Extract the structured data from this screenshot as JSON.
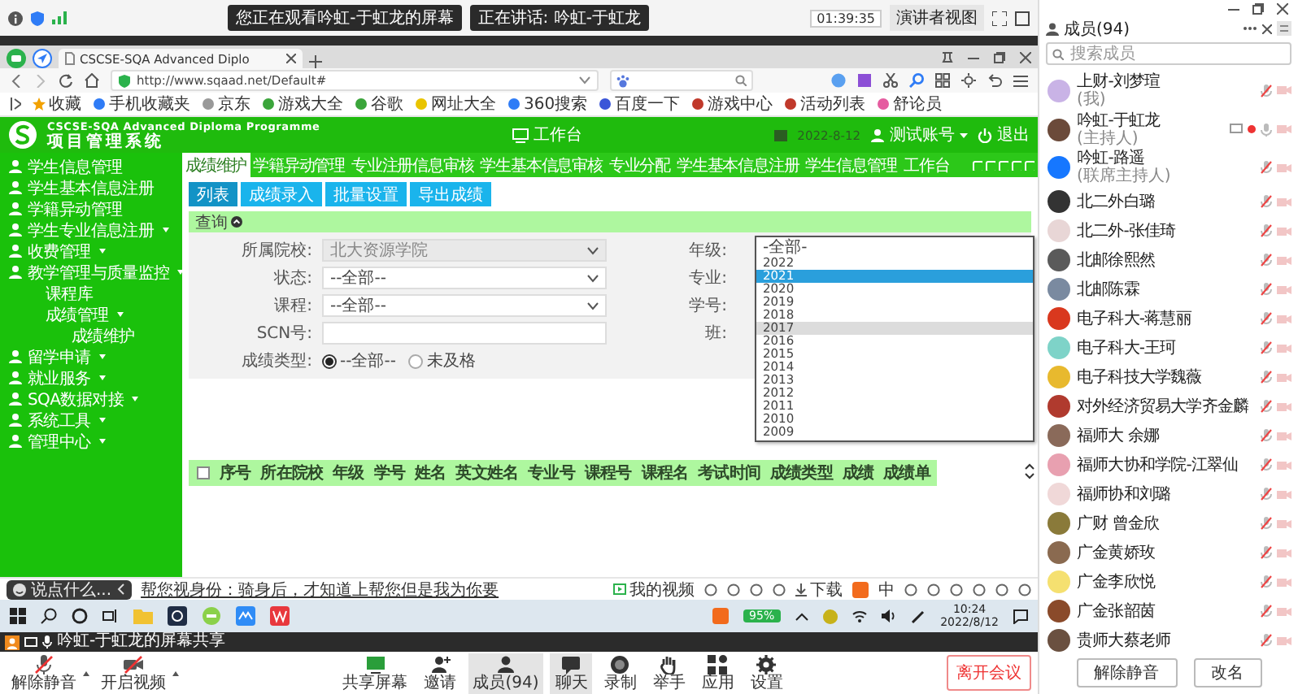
{
  "meeting_top": {
    "viewing_notice": "您正在观看吟虹-于虹龙的屏幕",
    "speaking_notice": "正在讲话: 吟虹-于虹龙",
    "timer": "01:39:35",
    "view_button": "演讲者视图"
  },
  "browser": {
    "tab_title": "CSCSE-SQA Advanced Diplo",
    "url": "http://www.sqaad.net/Default#",
    "bookmarks": [
      "收藏",
      "手机收藏夹",
      "京东",
      "游戏大全",
      "谷歌",
      "网址大全",
      "360搜索",
      "百度一下",
      "游戏中心",
      "活动列表",
      "舒论员"
    ]
  },
  "app": {
    "title_en": "CSCSE-SQA Advanced Diploma Programme",
    "title": "项目管理系统",
    "workbench": "工作台",
    "date": "2022-8-12",
    "account": "测试账号",
    "logout": "退出",
    "sidebar": {
      "items": [
        {
          "label": "学生信息管理",
          "kind": "link"
        },
        {
          "label": "学生基本信息注册",
          "kind": "link"
        },
        {
          "label": "学籍异动管理",
          "kind": "link"
        },
        {
          "label": "学生专业信息注册",
          "kind": "group"
        },
        {
          "label": "收费管理",
          "kind": "group"
        },
        {
          "label": "教学管理与质量监控",
          "kind": "group",
          "children": [
            {
              "label": "课程库",
              "kind": "link"
            },
            {
              "label": "成绩管理",
              "kind": "group",
              "children": [
                {
                  "label": "成绩维护",
                  "kind": "link"
                }
              ]
            }
          ]
        },
        {
          "label": "留学申请",
          "kind": "group"
        },
        {
          "label": "就业服务",
          "kind": "group"
        },
        {
          "label": "SQA数据对接",
          "kind": "group"
        },
        {
          "label": "系统工具",
          "kind": "group"
        },
        {
          "label": "管理中心",
          "kind": "group"
        }
      ]
    },
    "tabs": [
      {
        "label": "成绩维护",
        "selected": true
      },
      {
        "label": "学籍异动管理",
        "selected": false
      },
      {
        "label": "专业注册信息审核",
        "selected": false
      },
      {
        "label": "学生基本信息审核",
        "selected": false
      },
      {
        "label": "专业分配",
        "selected": false
      },
      {
        "label": "学生基本信息注册",
        "selected": false
      },
      {
        "label": "学生信息管理",
        "selected": false
      },
      {
        "label": "工作台",
        "selected": false
      }
    ],
    "toolbar_buttons": [
      {
        "label": "列表",
        "selected": true
      },
      {
        "label": "成绩录入",
        "selected": false
      },
      {
        "label": "批量设置",
        "selected": false
      },
      {
        "label": "导出成绩",
        "selected": false
      }
    ],
    "query": {
      "title": "查询",
      "fields": [
        {
          "label": "所属院校:",
          "kind": "select",
          "value": "北大资源学院",
          "disabled": true
        },
        {
          "label": "状态:",
          "kind": "select",
          "value": "--全部--",
          "disabled": false
        },
        {
          "label": "课程:",
          "kind": "select",
          "value": "--全部--",
          "disabled": false
        },
        {
          "label": "SCN号:",
          "kind": "text"
        }
      ],
      "right_labels": [
        "年级:",
        "专业:",
        "学号:",
        "班:"
      ],
      "score_type": {
        "label": "成绩类型:",
        "options": [
          {
            "label": "--全部--",
            "selected": true
          },
          {
            "label": "未及格",
            "selected": false
          }
        ]
      },
      "grade_dropdown": {
        "options": [
          {
            "label": "-全部-",
            "selected": false,
            "hovered": false
          },
          {
            "label": "2022",
            "selected": false,
            "hovered": false
          },
          {
            "label": "2021",
            "selected": true,
            "hovered": false
          },
          {
            "label": "2020",
            "selected": false,
            "hovered": false
          },
          {
            "label": "2019",
            "selected": false,
            "hovered": false
          },
          {
            "label": "2018",
            "selected": false,
            "hovered": false
          },
          {
            "label": "2017",
            "selected": false,
            "hovered": true
          },
          {
            "label": "2016",
            "selected": false,
            "hovered": false
          },
          {
            "label": "2015",
            "selected": false,
            "hovered": false
          },
          {
            "label": "2014",
            "selected": false,
            "hovered": false
          },
          {
            "label": "2013",
            "selected": false,
            "hovered": false
          },
          {
            "label": "2012",
            "selected": false,
            "hovered": false
          },
          {
            "label": "2011",
            "selected": false,
            "hovered": false
          },
          {
            "label": "2010",
            "selected": false,
            "hovered": false
          },
          {
            "label": "2009",
            "selected": false,
            "hovered": false
          }
        ]
      }
    },
    "table": {
      "select_all": {
        "checked": false
      },
      "columns": [
        "序号",
        "所在院校",
        "年级",
        "学号",
        "姓名",
        "英文姓名",
        "专业号",
        "课程号",
        "课程名",
        "考试时间",
        "成绩类型",
        "成绩",
        "成绩单"
      ]
    }
  },
  "status_bar": {
    "chat_placeholder": "说点什么...",
    "link_text": "帮您视身份：骑身后，才知道上帮您但是我为你要",
    "video_label": "我的视频",
    "download_label": "下载",
    "ime": "中"
  },
  "taskbar": {
    "battery": "95%",
    "time": "10:24",
    "date": "2022/8/12"
  },
  "share_bar": {
    "title": "吟虹-于虹龙的屏幕共享"
  },
  "meeting_toolbar": {
    "left": [
      {
        "label": "解除静音"
      },
      {
        "label": "开启视频"
      }
    ],
    "center": [
      {
        "label": "共享屏幕",
        "active": false
      },
      {
        "label": "邀请",
        "active": false
      },
      {
        "label": "成员(94)",
        "active": true
      },
      {
        "label": "聊天",
        "active": true
      },
      {
        "label": "录制",
        "active": false
      },
      {
        "label": "举手",
        "active": false
      },
      {
        "label": "应用",
        "active": false
      },
      {
        "label": "设置",
        "active": false
      }
    ],
    "leave": "离开会议"
  },
  "members_panel": {
    "title": "成员(94)",
    "search": {
      "placeholder": "搜索成员"
    },
    "members": [
      {
        "name": "上财-刘梦瑄",
        "role": "(我)",
        "muted": true,
        "sharing": false
      },
      {
        "name": "吟虹-于虹龙",
        "role": "(主持人)",
        "muted": false,
        "sharing": true
      },
      {
        "name": "吟虹-路遥",
        "role": "(联席主持人)",
        "muted": true,
        "sharing": false
      },
      {
        "name": "北二外白璐",
        "muted": true,
        "sharing": false
      },
      {
        "name": "北二外-张佳琦",
        "muted": true,
        "sharing": false
      },
      {
        "name": "北邮徐熙然",
        "muted": true,
        "sharing": false
      },
      {
        "name": "北邮陈霖",
        "muted": true,
        "sharing": false
      },
      {
        "name": "电子科大-蒋慧丽",
        "muted": true,
        "sharing": false
      },
      {
        "name": "电子科大-王珂",
        "muted": true,
        "sharing": false
      },
      {
        "name": "电子科技大学魏薇",
        "muted": true,
        "sharing": false
      },
      {
        "name": "对外经济贸易大学齐金麟",
        "muted": true,
        "sharing": false
      },
      {
        "name": "福师大 余娜",
        "muted": true,
        "sharing": false
      },
      {
        "name": "福师大协和学院-江翠仙",
        "muted": true,
        "sharing": false
      },
      {
        "name": "福师协和刘璐",
        "muted": true,
        "sharing": false
      },
      {
        "name": "广财 曾金欣",
        "muted": true,
        "sharing": false
      },
      {
        "name": "广金黄娇玫",
        "muted": true,
        "sharing": false
      },
      {
        "name": "广金李欣悦",
        "muted": true,
        "sharing": false
      },
      {
        "name": "广金张韶茵",
        "muted": true,
        "sharing": false
      },
      {
        "name": "贵师大蔡老师",
        "muted": true,
        "sharing": false
      }
    ],
    "buttons": [
      "解除静音",
      "改名"
    ]
  }
}
